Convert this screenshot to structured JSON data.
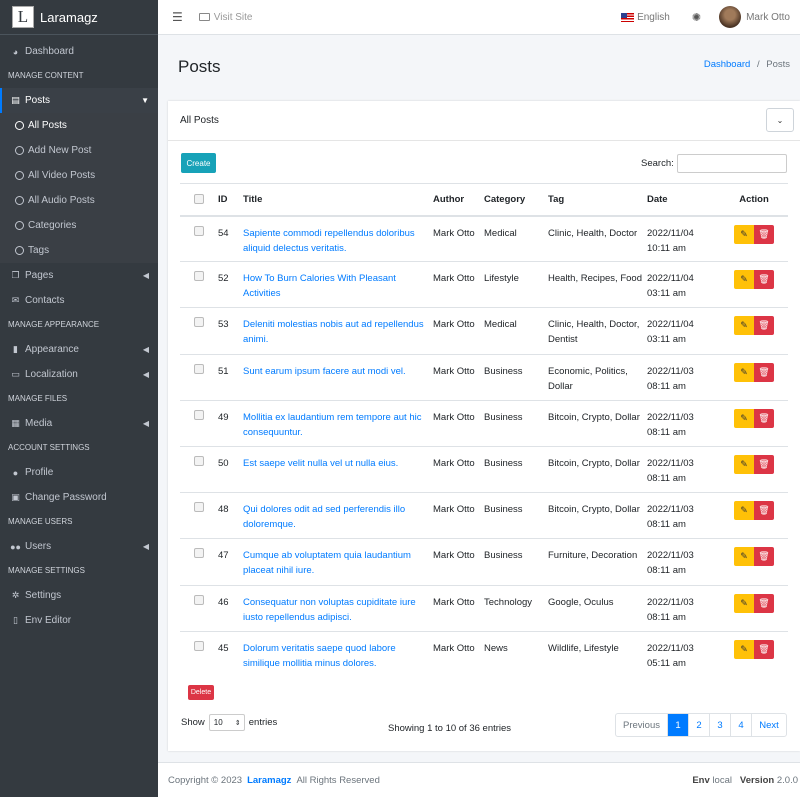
{
  "app": {
    "brand_letter": "L",
    "brand_name": "Laramagz"
  },
  "sidebar": {
    "dashboard": "Dashboard",
    "h_content": "MANAGE CONTENT",
    "posts": "Posts",
    "sub": [
      "All Posts",
      "Add New Post",
      "All Video Posts",
      "All Audio Posts",
      "Categories",
      "Tags"
    ],
    "pages": "Pages",
    "contacts": "Contacts",
    "h_appearance": "MANAGE APPEARANCE",
    "appearance": "Appearance",
    "localization": "Localization",
    "h_files": "MANAGE FILES",
    "media": "Media",
    "h_account": "ACCOUNT SETTINGS",
    "profile": "Profile",
    "change_password": "Change Password",
    "h_users": "MANAGE USERS",
    "users": "Users",
    "h_settings": "MANAGE SETTINGS",
    "settings": "Settings",
    "env_editor": "Env Editor"
  },
  "topbar": {
    "visit_site": "Visit Site",
    "language": "English",
    "user_name": "Mark Otto"
  },
  "header": {
    "title": "Posts",
    "breadcrumb_home": "Dashboard",
    "breadcrumb_sep": "/",
    "breadcrumb_current": "Posts"
  },
  "card": {
    "title": "All Posts",
    "create": "Create",
    "search_label": "Search:",
    "columns": [
      "ID",
      "Title",
      "Author",
      "Category",
      "Tag",
      "Date",
      "Action"
    ],
    "rows": [
      {
        "id": "54",
        "title": "Sapiente commodi repellendus doloribus aliquid delectus veritatis.",
        "author": "Mark Otto",
        "category": "Medical",
        "tag": "Clinic, Health, Doctor",
        "date": "2022/11/04 10:11 am"
      },
      {
        "id": "52",
        "title": "How To Burn Calories With Pleasant Activities",
        "author": "Mark Otto",
        "category": "Lifestyle",
        "tag": "Health, Recipes, Food",
        "date": "2022/11/04 03:11 am"
      },
      {
        "id": "53",
        "title": "Deleniti molestias nobis aut ad repellendus animi.",
        "author": "Mark Otto",
        "category": "Medical",
        "tag": "Clinic, Health, Doctor, Dentist",
        "date": "2022/11/04 03:11 am"
      },
      {
        "id": "51",
        "title": "Sunt earum ipsum facere aut modi vel.",
        "author": "Mark Otto",
        "category": "Business",
        "tag": "Economic, Politics, Dollar",
        "date": "2022/11/03 08:11 am"
      },
      {
        "id": "49",
        "title": "Mollitia ex laudantium rem tempore aut hic consequuntur.",
        "author": "Mark Otto",
        "category": "Business",
        "tag": "Bitcoin, Crypto, Dollar",
        "date": "2022/11/03 08:11 am"
      },
      {
        "id": "50",
        "title": "Est saepe velit nulla vel ut nulla eius.",
        "author": "Mark Otto",
        "category": "Business",
        "tag": "Bitcoin, Crypto, Dollar",
        "date": "2022/11/03 08:11 am"
      },
      {
        "id": "48",
        "title": "Qui dolores odit ad sed perferendis illo doloremque.",
        "author": "Mark Otto",
        "category": "Business",
        "tag": "Bitcoin, Crypto, Dollar",
        "date": "2022/11/03 08:11 am"
      },
      {
        "id": "47",
        "title": "Cumque ab voluptatem quia laudantium placeat nihil iure.",
        "author": "Mark Otto",
        "category": "Business",
        "tag": "Furniture, Decoration",
        "date": "2022/11/03 08:11 am"
      },
      {
        "id": "46",
        "title": "Consequatur non voluptas cupiditate iure iusto repellendus adipisci.",
        "author": "Mark Otto",
        "category": "Technology",
        "tag": "Google, Oculus",
        "date": "2022/11/03 08:11 am"
      },
      {
        "id": "45",
        "title": "Dolorum veritatis saepe quod labore similique mollitia minus dolores.",
        "author": "Mark Otto",
        "category": "News",
        "tag": "Wildlife, Lifestyle",
        "date": "2022/11/03 05:11 am"
      }
    ],
    "delete": "Delete",
    "show": "Show",
    "page_length": "10",
    "entries": "entries",
    "showing": "Showing 1 to 10 of 36 entries",
    "pagination": {
      "previous": "Previous",
      "pages": [
        "1",
        "2",
        "3",
        "4"
      ],
      "current": "1",
      "next": "Next"
    }
  },
  "footer": {
    "copyright": "Copyright © 2023",
    "brand": "Laramagz",
    "rights": "All Rights Reserved",
    "env_label": "Env",
    "env_value": "local",
    "version_label": "Version",
    "version_value": "2.0.0"
  },
  "colors": {
    "primary": "#007bff",
    "sidebar_bg": "#343a40",
    "create": "#17a2b8",
    "edit": "#ffc107",
    "delete": "#dc3545"
  }
}
